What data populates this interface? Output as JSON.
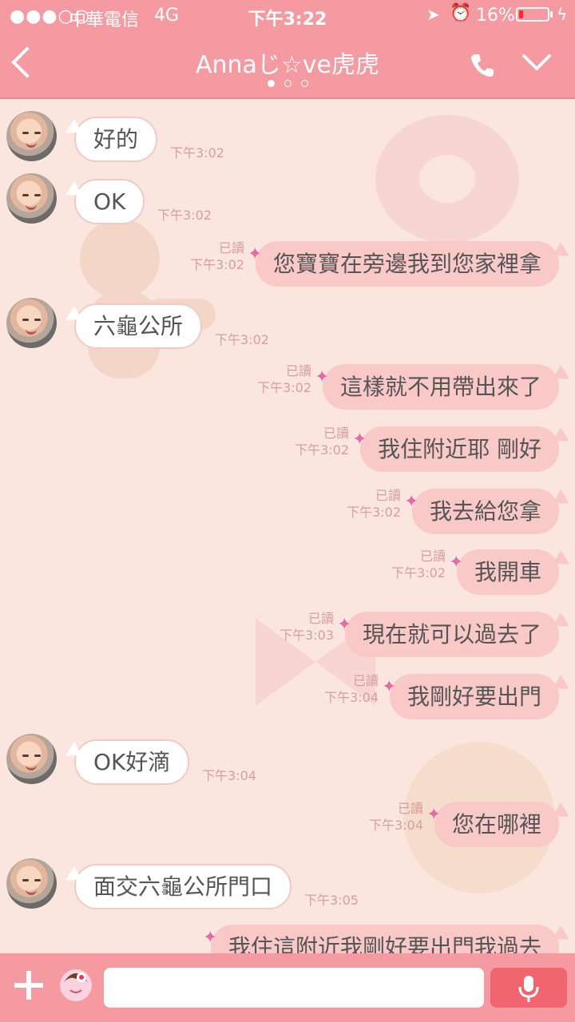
{
  "status_bar": {
    "signal": "●●●○○",
    "carrier": "中華電信",
    "network": "4G",
    "time": "下午3:22",
    "battery": "16%",
    "battery_level": 0.16
  },
  "header": {
    "title": "Annaじ☆ve虎虎",
    "page_count": 3,
    "active_page": 0
  },
  "messages": [
    {
      "side": "in",
      "text": "好的",
      "time": "下午3:02"
    },
    {
      "side": "in",
      "text": "OK",
      "time": "下午3:02"
    },
    {
      "side": "out",
      "text": "您寶寶在旁邊我到您家裡拿",
      "read": "已讀",
      "time": "下午3:02"
    },
    {
      "side": "in",
      "text": "六龜公所",
      "time": "下午3:02"
    },
    {
      "side": "out",
      "text": "這樣就不用帶出來了",
      "read": "已讀",
      "time": "下午3:02"
    },
    {
      "side": "out",
      "text": "我住附近耶 剛好",
      "read": "已讀",
      "time": "下午3:02"
    },
    {
      "side": "out",
      "text": "我去給您拿",
      "read": "已讀",
      "time": "下午3:02"
    },
    {
      "side": "out",
      "text": "我開車",
      "read": "已讀",
      "time": "下午3:02"
    },
    {
      "side": "out",
      "text": "現在就可以過去了",
      "read": "已讀",
      "time": "下午3:03"
    },
    {
      "side": "out",
      "text": "我剛好要出門",
      "read": "已讀",
      "time": "下午3:04"
    },
    {
      "side": "in",
      "text": "OK好滴",
      "time": "下午3:04"
    },
    {
      "side": "out",
      "text": "您在哪裡",
      "read": "已讀",
      "time": "下午3:04"
    },
    {
      "side": "in",
      "text": "面交六龜公所門口",
      "time": "下午3:05"
    },
    {
      "side": "out",
      "text": "我住這附近我剛好要出門我過去",
      "read": "",
      "time": ""
    }
  ],
  "input": {
    "placeholder": "",
    "value": ""
  },
  "colors": {
    "accent": "#f59aa0",
    "background": "#fbe6df",
    "bubble_out": "#f9c9c8",
    "bubble_in": "#ffffff",
    "mic": "#f0656e"
  }
}
